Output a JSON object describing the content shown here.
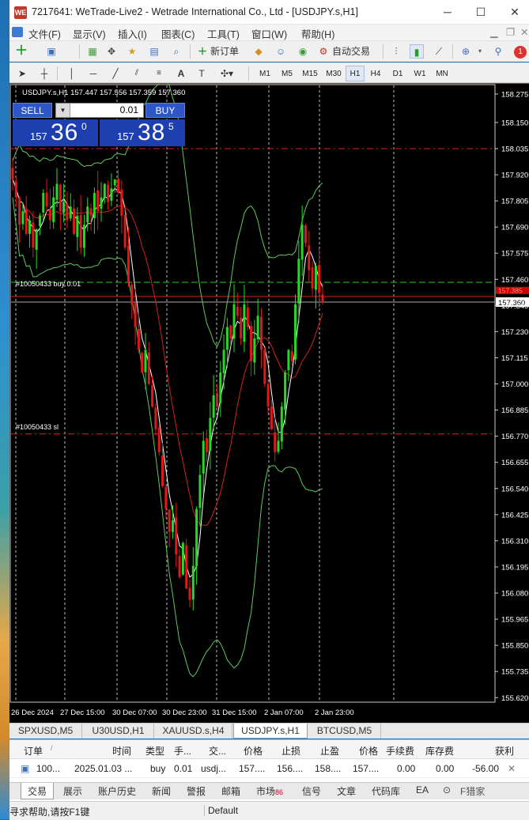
{
  "window": {
    "title": "7217641: WeTrade-Live2 - Wetrade International Co., Ltd - [USDJPY.s,H1]",
    "logo_text": "WE",
    "minimize": "─",
    "maximize": "☐",
    "close": "✕"
  },
  "menu": [
    "文件(F)",
    "显示(V)",
    "插入(I)",
    "图表(C)",
    "工具(T)",
    "窗口(W)",
    "帮助(H)"
  ],
  "toolbar": {
    "new_order": "新订单",
    "auto_trade": "自动交易",
    "notification_count": "1"
  },
  "timeframes": [
    "M1",
    "M5",
    "M15",
    "M30",
    "H1",
    "H4",
    "D1",
    "W1",
    "MN"
  ],
  "active_timeframe": "H1",
  "chart": {
    "header": "USDJPY.s,H1  157.447 157.556 157.359 157.360",
    "sell_label": "SELL",
    "buy_label": "BUY",
    "lot": "0.01",
    "bid_big": "157",
    "bid_main": "36",
    "bid_sup": "0",
    "ask_big": "157",
    "ask_main": "38",
    "ask_sup": "5",
    "order_line_label": "#10050433 buy 0.01",
    "sl_line_label": "#10050433 sl",
    "current_price_label": "157.360",
    "red_price_label": "157.385"
  },
  "chart_data": {
    "type": "candlestick",
    "symbol": "USDJPY.s",
    "timeframe": "H1",
    "y_ticks": [
      "158.275",
      "158.150",
      "158.035",
      "157.920",
      "157.805",
      "157.690",
      "157.575",
      "157.460",
      "157.345",
      "157.230",
      "157.115",
      "157.000",
      "156.885",
      "156.770",
      "156.655",
      "156.540",
      "156.425",
      "156.310",
      "156.195",
      "156.080",
      "155.965",
      "155.850",
      "155.735",
      "155.620"
    ],
    "x_ticks": [
      "26 Dec 2024",
      "27 Dec 15:00",
      "30 Dec 07:00",
      "30 Dec 23:00",
      "31 Dec 15:00",
      "2 Jan 07:00",
      "2 Jan 23:00"
    ],
    "ylim": [
      155.6,
      158.32
    ],
    "levels": {
      "take_profit": 158.035,
      "buy_entry": 157.447,
      "stop_loss": 156.78,
      "bid": 157.36,
      "ask": 157.385
    },
    "closes": [
      157.9,
      157.82,
      157.7,
      157.76,
      157.66,
      157.72,
      157.6,
      157.68,
      157.74,
      157.84,
      157.78,
      157.72,
      157.82,
      157.88,
      157.76,
      157.8,
      157.72,
      157.78,
      157.66,
      157.74,
      157.6,
      157.7,
      157.78,
      157.74,
      157.84,
      157.76,
      157.82,
      157.88,
      157.8,
      157.86,
      157.9,
      157.84,
      157.74,
      157.6,
      157.45,
      157.35,
      157.25,
      157.15,
      157.05,
      157.15,
      157.0,
      156.9,
      156.8,
      156.7,
      156.55,
      156.45,
      156.35,
      156.4,
      156.25,
      156.15,
      156.3,
      156.1,
      156.05,
      156.2,
      156.45,
      156.6,
      156.75,
      156.7,
      156.85,
      156.95,
      156.9,
      157.05,
      157.15,
      157.25,
      157.2,
      157.35,
      157.3,
      157.2,
      157.35,
      157.25,
      157.1,
      157.2,
      157.3,
      157.15,
      157.0,
      156.9,
      156.8,
      156.7,
      156.75,
      156.9,
      157.05,
      157.15,
      157.1,
      157.35,
      157.55,
      157.7,
      157.62,
      157.5,
      157.42,
      157.52,
      157.4,
      157.36
    ]
  },
  "symbol_tabs": [
    "SPXUSD,M5",
    "U30USD,H1",
    "XAUUSD.s,H4",
    "USDJPY.s,H1",
    "BTCUSD,M5"
  ],
  "active_symbol_tab": "USDJPY.s,H1",
  "terminal": {
    "headers": [
      "订单",
      "时间",
      "类型",
      "手...",
      "交...",
      "价格",
      "止损",
      "止盈",
      "价格",
      "手续费",
      "库存费",
      "获利"
    ],
    "row": [
      "100...",
      "2025.01.03 ...",
      "buy",
      "0.01",
      "usdj...",
      "157....",
      "156....",
      "158....",
      "157....",
      "0.00",
      "0.00",
      "-56.00"
    ],
    "close_row": "✕",
    "bottom_tabs": [
      "交易",
      "展示",
      "账户历史",
      "新闻",
      "警报",
      "邮箱",
      "市场",
      "信号",
      "文章",
      "代码库",
      "EA"
    ],
    "market_badge": "86",
    "status_help": "寻求帮助,请按F1键",
    "status_profile": "Default",
    "watermark": "F猎家"
  }
}
